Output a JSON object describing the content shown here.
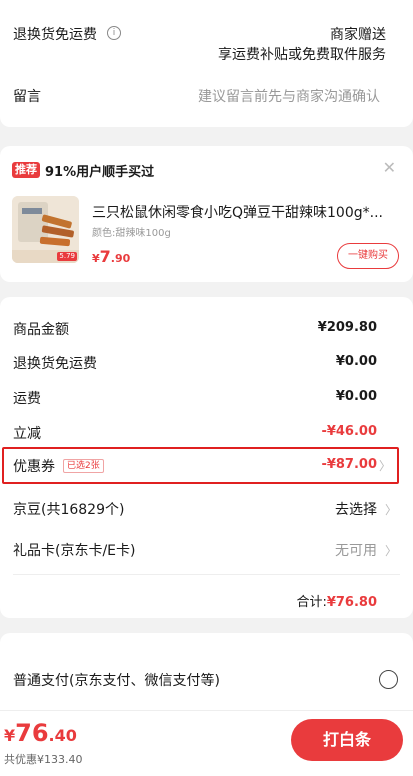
{
  "return_shipping": {
    "label": "退换货免运费",
    "value_line1": "商家赠送",
    "value_line2": "享运费补贴或免费取件服务"
  },
  "message": {
    "label": "留言",
    "placeholder": "建议留言前先与商家沟通确认"
  },
  "recommend": {
    "badge": "推荐",
    "headline": "91%用户顺手买过",
    "product_title": "三只松鼠休闲零食小吃Q弹豆干甜辣味100g*...",
    "variant": "颜色:甜辣味100g",
    "price_symbol": "¥",
    "price_int": "7",
    "price_dec": ".90",
    "thumb_price": "5.79",
    "buy_button": "一键购买"
  },
  "summary": {
    "rows": [
      {
        "label": "商品金额",
        "value": "¥209.80"
      },
      {
        "label": "退换货免运费",
        "value": "¥0.00"
      },
      {
        "label": "运费",
        "value": "¥0.00"
      },
      {
        "label": "立减",
        "value": "-¥46.00"
      }
    ],
    "coupon": {
      "label": "优惠券",
      "tag": "已选2张",
      "value": "-¥87.00"
    },
    "jingdou": {
      "label": "京豆(共16829个)",
      "value": "去选择"
    },
    "giftcard": {
      "label": "礼品卡(京东卡/E卡)",
      "value": "无可用"
    },
    "total_label": "合计:",
    "total_value": "¥76.80"
  },
  "payment": {
    "label": "普通支付(京东支付、微信支付等)"
  },
  "footer": {
    "price_symbol": "¥",
    "price_int": "76",
    "price_dec": ".40",
    "saving": "共优惠¥133.40",
    "pay_button": "打白条"
  },
  "colors": {
    "accent": "#e93b3d",
    "highlight_box": "#e02020",
    "background": "#f2f2f2"
  }
}
